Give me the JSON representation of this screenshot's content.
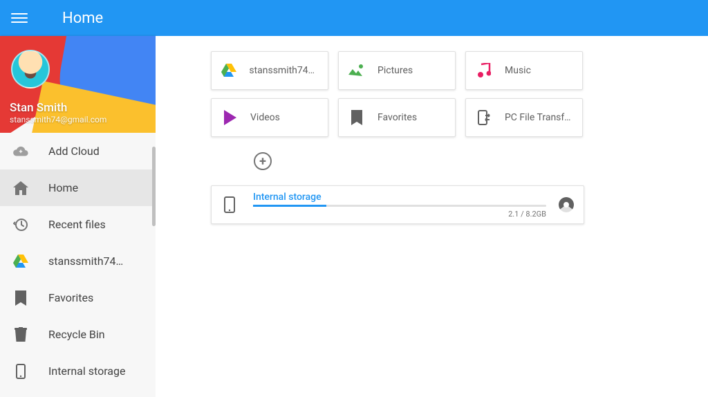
{
  "appbar": {
    "title": "Home"
  },
  "profile": {
    "name": "Stan Smith",
    "email": "stanssmith74@gmail.com"
  },
  "sidebar": {
    "items": [
      {
        "label": "Add Cloud",
        "icon": "cloud-plus"
      },
      {
        "label": "Home",
        "icon": "home",
        "active": true
      },
      {
        "label": "Recent files",
        "icon": "history"
      },
      {
        "label": "stanssmith74…",
        "icon": "gdrive"
      },
      {
        "label": "Favorites",
        "icon": "bookmark"
      },
      {
        "label": "Recycle Bin",
        "icon": "trash"
      },
      {
        "label": "Internal storage",
        "icon": "phone"
      }
    ]
  },
  "cards": [
    {
      "label": "stanssmith74@…",
      "icon": "gdrive"
    },
    {
      "label": "Pictures",
      "icon": "pictures"
    },
    {
      "label": "Music",
      "icon": "music"
    },
    {
      "label": "Videos",
      "icon": "videos"
    },
    {
      "label": "Favorites",
      "icon": "bookmark"
    },
    {
      "label": "PC File Transfer",
      "icon": "transfer"
    }
  ],
  "storage": {
    "title": "Internal storage",
    "usage": "2.1 / 8.2GB",
    "pct": 25
  }
}
